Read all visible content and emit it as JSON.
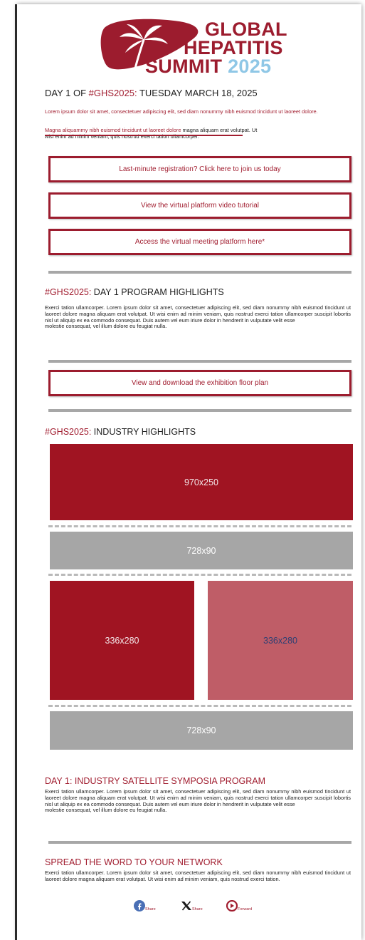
{
  "header": {
    "logo": {
      "line1": "GLOBAL",
      "line2": "HEPATITIS",
      "line3": "SUMMIT",
      "year": "2025"
    }
  },
  "day": {
    "prefix": "DAY 1 OF ",
    "tag": "#GHS2025:",
    "date": " TUESDAY MARCH 18, 2025",
    "lead": "Lorem ipsum dolor sit amet, consectetuer adipiscing elit, sed diam nonummy nibh euismod tincidunt ut laoreet dolore.",
    "mag_red": "Magna aliquammy nibh euismod tincidunt ut laoreet dolore",
    "mag_black": " magna aliquam erat volutpat. Ut",
    "mag_line2": "wisi enim ad minim veniam, quis nostrud exerci tation ullamcorper."
  },
  "buttons": {
    "registration": "Last-minute registration? Click here to join us today",
    "tutorial": "View the virtual platform video tutorial",
    "access": "Access the virtual meeting platform here*",
    "floorplan": "View and download the exhibition floor plan"
  },
  "program": {
    "tag": "#GHS2025:",
    "title": " DAY 1 PROGRAM HIGHLIGHTS",
    "body": "Exerci tation ullamcorper. Lorem ipsum dolor sit amet, consectetuer adipiscing elit, sed diam nonummy nibh euismod tincidunt ut laoreet dolore magna aliquam erat volutpat. Ut wisi enim ad minim veniam, quis nostrud exerci tation ullamcorper suscipit lobortis nisl ut aliquip ex ea commodo consequat. Duis autem vel eum iriure dolor in hendrerit in vulputate velit esse",
    "body2": "molestie consequat, vel illum dolore eu feugiat nulla."
  },
  "industry": {
    "tag": "#GHS2025:",
    "title": " INDUSTRY HIGHLIGHTS",
    "ads": [
      "970x250",
      "728x90",
      "336x280",
      "336x280",
      "728x90"
    ]
  },
  "symposia": {
    "title": "DAY 1: INDUSTRY SATELLITE SYMPOSIA PROGRAM",
    "body": "Exerci tation ullamcorper. Lorem ipsum dolor sit amet, consectetuer adipiscing elit, sed diam nonummy nibh euismod tincidunt ut laoreet dolore magna aliquam erat volutpat. Ut wisi enim ad minim veniam, quis nostrud exerci tation ullamcorper suscipit lobortis nisl ut aliquip ex ea commodo consequat. Duis autem vel eum iriure dolor in hendrerit in vulputate velit esse",
    "body2": "molestie consequat, vel illum dolore eu feugiat nulla."
  },
  "spread": {
    "title": "SPREAD THE WORD TO YOUR NETWORK",
    "body": "Exerci tation ullamcorper. Lorem ipsum dolor sit amet, consectetuer adipiscing elit, sed diam nonummy nibh euismod tincidunt ut laoreet dolore magna aliquam erat volutpat. Ut wisi enim ad minim veniam, quis nostrud exerci tation."
  },
  "social": {
    "share_fb": "Share",
    "share_x": "Share",
    "forward": "Forward",
    "icons": [
      "facebook-icon",
      "x-icon",
      "forward-icon"
    ]
  },
  "colors": {
    "brand_red": "#9c1c2e",
    "ad_red": "#a01422",
    "ad_pink": "#bf5d67",
    "ad_grey": "#a6a6a6",
    "rule_grey": "#a7a7a7"
  }
}
